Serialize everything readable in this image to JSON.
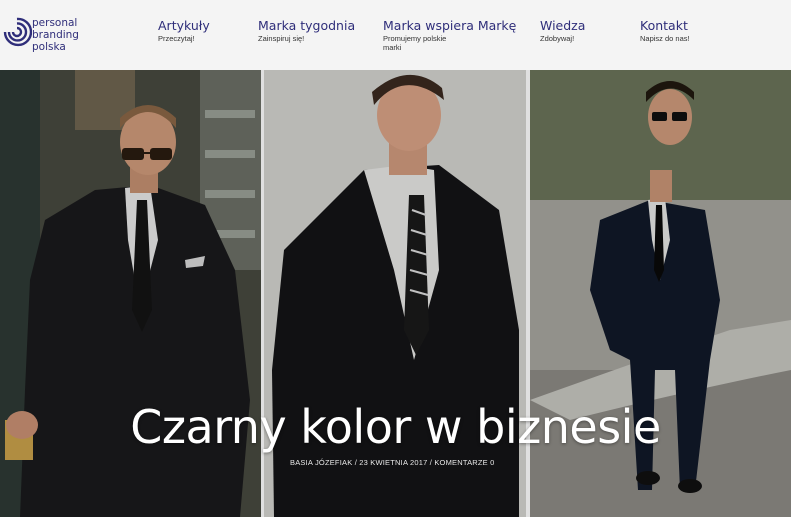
{
  "logo": {
    "lines": [
      "personal",
      "branding",
      "polska"
    ],
    "color": "#2f2e7a"
  },
  "nav": [
    {
      "title": "Artykuły",
      "subtitle": "Przeczytaj!"
    },
    {
      "title": "Marka tygodnia",
      "subtitle": "Zainspiruj się!"
    },
    {
      "title": "Marka wspiera Markę",
      "subtitle": "Promujemy polskie marki"
    },
    {
      "title": "Wiedza",
      "subtitle": "Zdobywaj!"
    },
    {
      "title": "Kontakt",
      "subtitle": "Napisz do nas!"
    }
  ],
  "hero": {
    "headline": "Czarny kolor w biznesie",
    "author": "BASIA JÓZEFIAK",
    "date": "23 KWIETNIA 2017",
    "comments": "KOMENTARZE 0",
    "separator": " / "
  }
}
